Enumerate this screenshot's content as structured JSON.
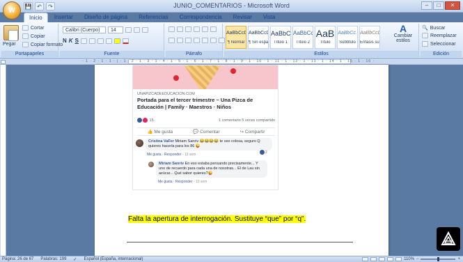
{
  "window": {
    "title": "JUNIO_COMENTARIOS - Microsoft Word",
    "minimize": "–",
    "maximize": "□",
    "close": "✕"
  },
  "qat": {
    "save": "💾",
    "undo": "↶",
    "redo": "↷"
  },
  "office_button": {
    "label": "W"
  },
  "tabs": [
    "Inicio",
    "Insertar",
    "Diseño de página",
    "Referencias",
    "Correspondencia",
    "Revisar",
    "Vista"
  ],
  "ribbon": {
    "clipboard": {
      "paste": "Pegar",
      "cut": "Cortar",
      "copy": "Copiar",
      "format_painter": "Copiar formato",
      "label": "Portapapeles"
    },
    "font": {
      "font_name": "Calibri (Cuerpo)",
      "font_size": "14",
      "bold": "N",
      "italic": "K",
      "underline": "S",
      "label": "Fuente"
    },
    "paragraph": {
      "label": "Párrafo"
    },
    "styles": {
      "items": [
        {
          "preview": "AaBbCcDc",
          "name": "¶ Normal"
        },
        {
          "preview": "AaBbCcDc",
          "name": "¶ Sin espa..."
        },
        {
          "preview": "AaBbC",
          "name": "Título 1"
        },
        {
          "preview": "AaBbCc",
          "name": "Título 2"
        },
        {
          "preview": "AaB",
          "name": "Título"
        },
        {
          "preview": "AaBbCc.",
          "name": "Subtítulo"
        },
        {
          "preview": "AaBbCcDi",
          "name": "Énfasis sutil"
        }
      ],
      "change": "Cambiar estilos",
      "label": "Estilos"
    },
    "editing": {
      "find": "Buscar",
      "replace": "Reemplazar",
      "select": "Seleccionar",
      "label": "Edición"
    }
  },
  "ruler": {
    "ticks": "· 1 · 2 · 1 · 1 · | · 1 · 2 · 1 · 3 · 1 · 4 · 1 · 5 · 1 · 6 · 1 · 7 · 1 · 8 · 1 · 9 · 1 · 10 · 1 · 11 · 1 · 12 · 1 · 13 · 1 · 14 · 1 · 15 · 1 · 16 · 1 · 17 · 1 · 18 ·"
  },
  "fb_post": {
    "link_domain": "UNAPIZCADEEDUCACION.COM",
    "link_title": "Portada para el tercer trimestre ~ Una Pizca de Educación | Family · Maestros · Niños",
    "reaction_count": "15",
    "stats": "1 comentario  5 veces compartido",
    "like": "Me gusta",
    "comment": "Comentar",
    "share": "Compartir",
    "comments": [
      {
        "author": "Cristina VaFer",
        "text": "Miriam Sanriv 😂😂😂😂 te veo colosa, seguro Q quieres hacerla para los 86 😜",
        "like": "Me gusta",
        "reply": "Responder",
        "time": "13 sem",
        "reacts": "2"
      },
      {
        "author": "Miriam Sanriv",
        "text": "En eso estaba pensando precisamente... Y uno de recuerdo para cada una de nosotras... El de Lau sin azúcar... Qué sabor quieres?😜",
        "like": "Me gusta",
        "reply": "Responder",
        "time": "13 sem"
      }
    ]
  },
  "document": {
    "highlight": "Falta la apertura de interrogación. Sustituye “que” por “q”."
  },
  "status": {
    "page": "Página: 26 de 67",
    "words": "Palabras: 199",
    "language": "Español (España, internacional)",
    "zoom": "110%"
  },
  "colors": {
    "highlight": "#ffff00",
    "ribbon": "#dbe7f7",
    "fb_link": "#385898"
  }
}
